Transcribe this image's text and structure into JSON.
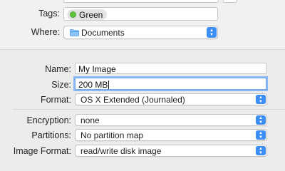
{
  "tags": {
    "label": "Tags:",
    "tag_name": "Green",
    "tag_color": "#5bc33d"
  },
  "where": {
    "label": "Where:",
    "value": "Documents",
    "icon": "folder-icon"
  },
  "form": {
    "name": {
      "label": "Name:",
      "value": "My Image"
    },
    "size": {
      "label": "Size:",
      "value": "200 MB"
    },
    "format": {
      "label": "Format:",
      "value": "OS X Extended (Journaled)"
    },
    "encryption": {
      "label": "Encryption:",
      "value": "none"
    },
    "partitions": {
      "label": "Partitions:",
      "value": "No partition map"
    },
    "image_format": {
      "label": "Image Format:",
      "value": "read/write disk image"
    }
  },
  "colors": {
    "accent": "#3b8ef6",
    "panel": "#f1f1f1",
    "background": "#ececec"
  }
}
